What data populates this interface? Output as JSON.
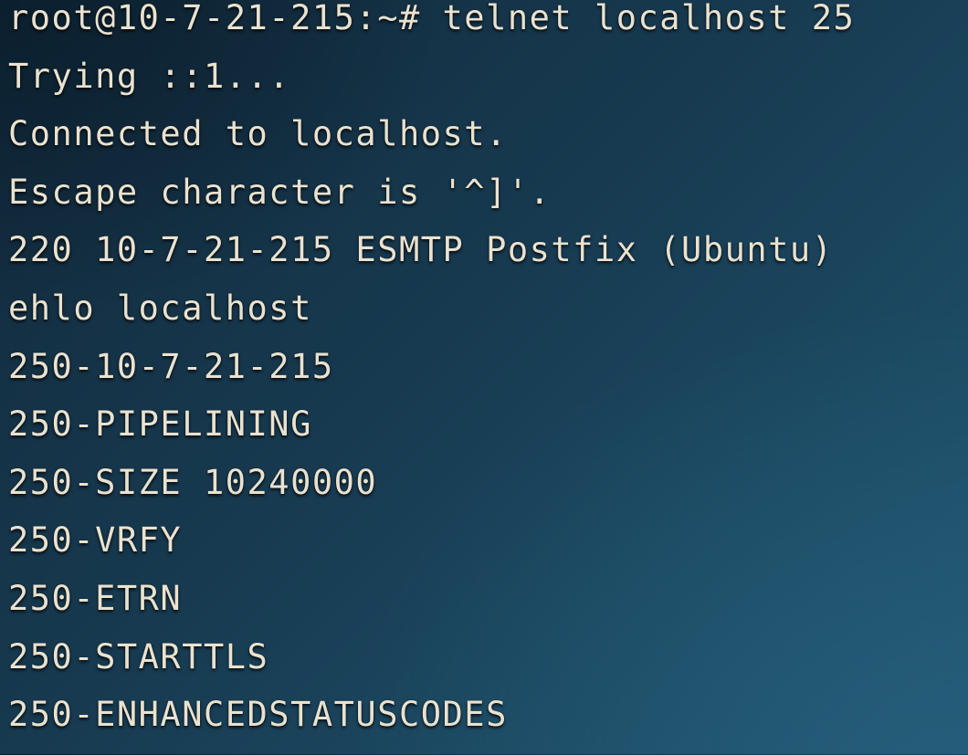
{
  "terminal": {
    "lines": [
      "root@10-7-21-215:~# telnet localhost 25",
      "Trying ::1...",
      "Connected to localhost.",
      "Escape character is '^]'.",
      "220 10-7-21-215 ESMTP Postfix (Ubuntu)",
      "ehlo localhost",
      "250-10-7-21-215",
      "250-PIPELINING",
      "250-SIZE 10240000",
      "250-VRFY",
      "250-ETRN",
      "250-STARTTLS",
      "250-ENHANCEDSTATUSCODES"
    ]
  }
}
